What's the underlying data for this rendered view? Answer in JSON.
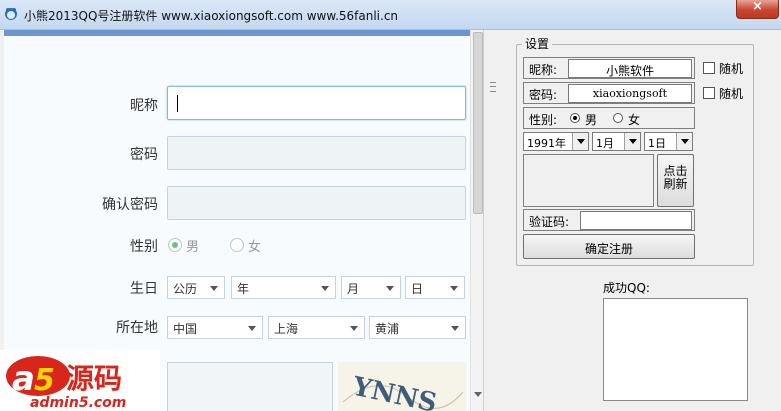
{
  "window": {
    "title": "小熊2013QQ号注册软件 www.xiaoxiongsoft.com www.56fanli.cn",
    "close_label": "×"
  },
  "web_form": {
    "nickname_label": "昵称",
    "password_label": "密码",
    "confirm_password_label": "确认密码",
    "gender_label": "性别",
    "gender_male": "男",
    "gender_female": "女",
    "gender_selected": "男",
    "birthday_label": "生日",
    "birthday_calendar": "公历",
    "birthday_year": "年",
    "birthday_month": "月",
    "birthday_day": "日",
    "location_label": "所在地",
    "location_country": "中国",
    "location_province": "上海",
    "location_district": "黄浦",
    "captcha_text": "YNNS"
  },
  "settings": {
    "group_title": "设置",
    "nickname_label": "昵称:",
    "nickname_value": "小熊软件",
    "random_label": "随机",
    "password_label": "密码:",
    "password_value": "xiaoxiongsoft",
    "gender_label": "性别:",
    "gender_male": "男",
    "gender_female": "女",
    "gender_selected": "男",
    "year": "1991年",
    "month": "1月",
    "day": "1日",
    "refresh_label_line1": "点击",
    "refresh_label_line2": "刷新",
    "captcha_label": "验证码:",
    "captcha_value": "",
    "submit_label": "确定注册"
  },
  "result": {
    "success_label": "成功QQ:"
  },
  "watermark": {
    "brand": "a5源码",
    "domain": "admin5.com"
  }
}
